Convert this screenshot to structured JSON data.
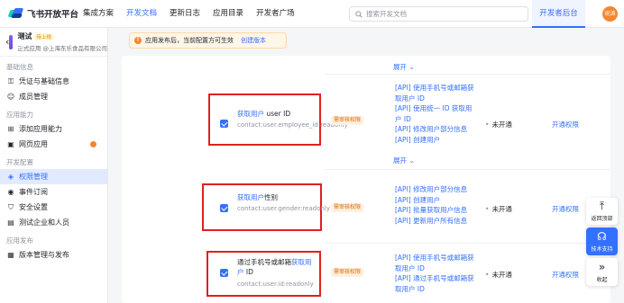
{
  "brand": {
    "name": "飞书开放平台"
  },
  "nav": {
    "items": [
      "集成方案",
      "开发文档",
      "更新日志",
      "应用目录",
      "开发者广场"
    ],
    "active_index": 1,
    "admin_label": "开发者后台"
  },
  "search": {
    "placeholder": "搜索开发文档"
  },
  "user": {
    "avatar_text": "祝涛"
  },
  "app": {
    "name": "测试",
    "badge": "待上线",
    "subtitle": "正式应用 @上海东乐食品有限公司"
  },
  "notice": {
    "text": "应用发布后，当前配置方可生效",
    "link": "创建版本"
  },
  "sidebar": {
    "groups": [
      {
        "title": "基础信息",
        "items": [
          {
            "label": "凭证与基础信息",
            "icon": "key-icon"
          },
          {
            "label": "成员管理",
            "icon": "user-icon"
          }
        ]
      },
      {
        "title": "应用能力",
        "items": [
          {
            "label": "添加应用能力",
            "icon": "plus-icon"
          },
          {
            "label": "网页应用",
            "icon": "web-icon"
          }
        ]
      },
      {
        "title": "开发配置",
        "items": [
          {
            "label": "权限管理",
            "icon": "shield-icon"
          },
          {
            "label": "事件订阅",
            "icon": "bell-icon"
          },
          {
            "label": "安全设置",
            "icon": "lock-icon"
          },
          {
            "label": "测试企业和人员",
            "icon": "team-icon"
          }
        ]
      },
      {
        "title": "应用发布",
        "items": [
          {
            "label": "版本管理与发布",
            "icon": "release-icon"
          }
        ]
      }
    ],
    "active": "权限管理"
  },
  "content": {
    "expand_label": "展开",
    "tag_label": "需审核权限",
    "status_label": "未开通",
    "action_label": "开通权限",
    "permissions": [
      {
        "title_link": "获取用户",
        "title_rest": " user ID",
        "code": "contact:user.employee_id:readonly",
        "apis": [
          "[API] 使用手机号或邮箱获取用户 ID",
          "[API] 使用统一 ID 获取用户 ID",
          "[API] 修改用户部分信息",
          "[API] 创建用户"
        ]
      },
      {
        "title_link": "获取用户",
        "title_rest": "性别",
        "code": "contact:user.gender:readonly",
        "apis": [
          "[API] 修改用户部分信息",
          "[API] 创建用户",
          "[API] 批量获取用户信息",
          "[API] 更新用户所有信息"
        ]
      },
      {
        "title_pre": "通过手机号或邮箱",
        "title_link": "获取用户",
        "title_rest": " ID",
        "code": "contact:user.id:readonly",
        "apis": [
          "[API] 使用手机号或邮箱获取用户 ID",
          "[API] 通过手机号或邮箱获取用户 ID"
        ]
      }
    ]
  },
  "float_tools": {
    "top": "返回顶部",
    "support": "技术支持",
    "collapse": "收起"
  }
}
